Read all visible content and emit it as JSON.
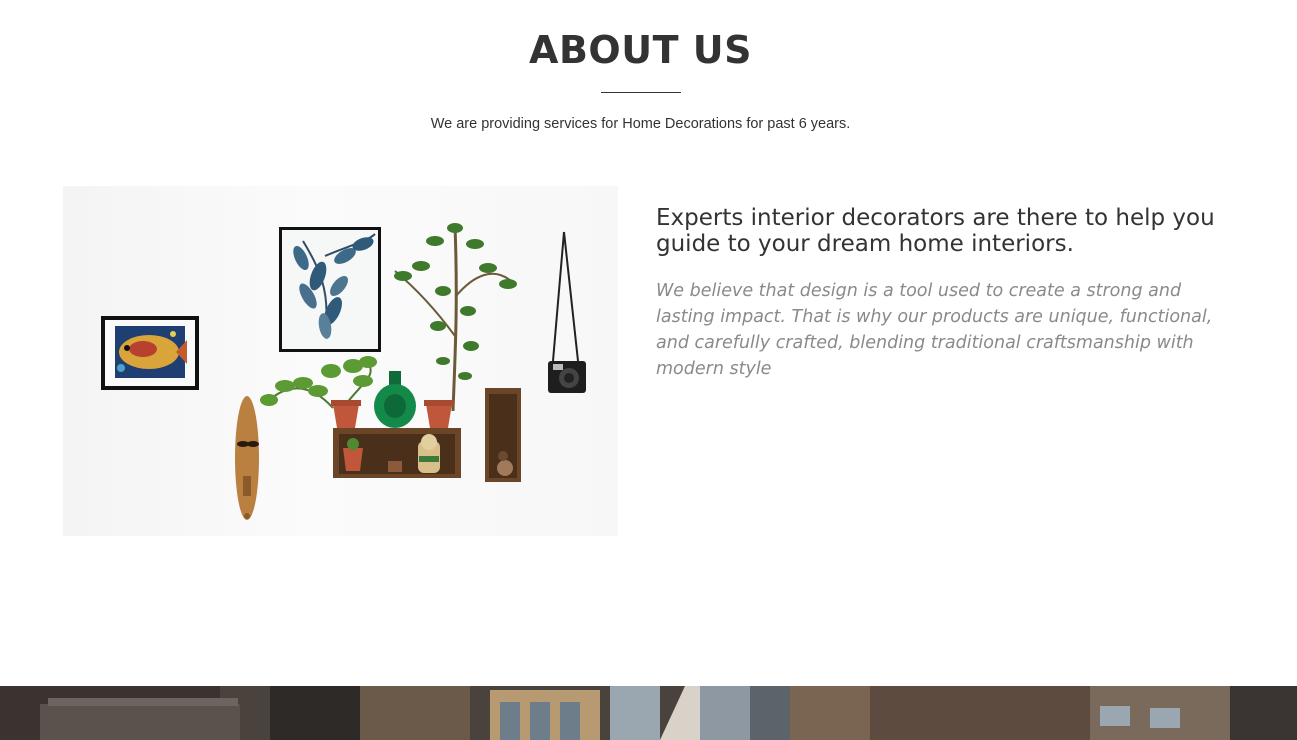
{
  "about": {
    "title": "ABOUT US",
    "subtitle": "We are providing services for Home Decorations for past 6 years.",
    "heading": "Experts interior decorators are there to help you guide to your dream home interiors.",
    "description": "We believe that design is a tool used to create a strong and lasting impact. That is why our products are unique, functional, and carefully crafted, blending traditional craftsmanship with modern style"
  },
  "colors": {
    "text": "#333333",
    "muted": "#8a8a8a",
    "background": "#ffffff"
  }
}
